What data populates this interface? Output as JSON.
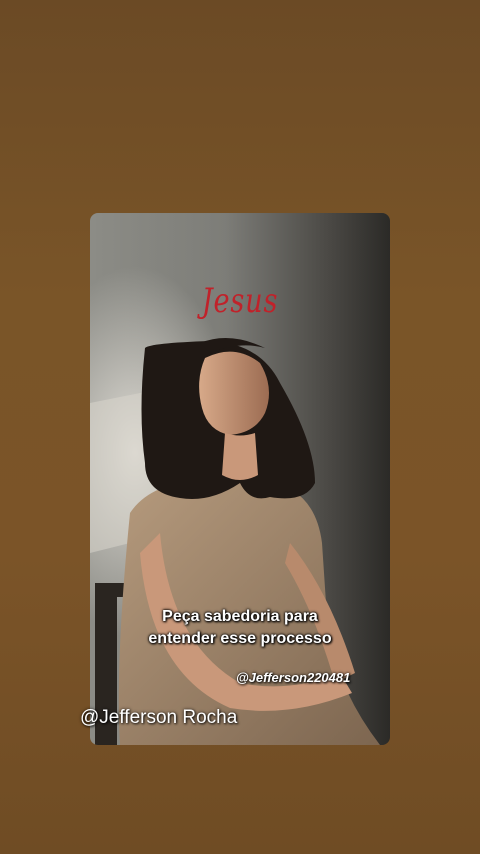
{
  "story": {
    "overlay_word": "Jesus",
    "caption_lines": [
      "Peça sabedoria para",
      "entender esse processo"
    ],
    "inner_handle": "@Jefferson220481"
  },
  "watermark": {
    "handle": "@Jefferson Rocha"
  },
  "colors": {
    "background": "#7a5528",
    "accent_red": "#c0222a",
    "caption_text": "#ffffff"
  }
}
